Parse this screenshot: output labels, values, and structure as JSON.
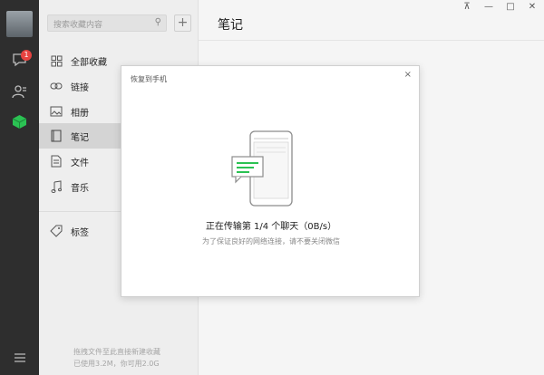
{
  "window": {
    "controls": [
      "⊼",
      "—",
      "□",
      "✕"
    ]
  },
  "rail": {
    "badge": "1"
  },
  "search": {
    "placeholder": "搜索收藏内容"
  },
  "nav": {
    "items": [
      {
        "label": "全部收藏",
        "icon": "grid-icon"
      },
      {
        "label": "链接",
        "icon": "link-icon"
      },
      {
        "label": "相册",
        "icon": "image-icon"
      },
      {
        "label": "笔记",
        "icon": "note-icon"
      },
      {
        "label": "文件",
        "icon": "file-icon"
      },
      {
        "label": "音乐",
        "icon": "music-icon"
      }
    ],
    "tag": {
      "label": "标签",
      "icon": "tag-icon"
    },
    "active": "笔记"
  },
  "footer": {
    "line1": "拖拽文件至此直接新建收藏",
    "line2": "已使用3.2M，你可用2.0G"
  },
  "main": {
    "title": "笔记"
  },
  "dialog": {
    "title": "恢复到手机",
    "close": "×",
    "status": "正在传输第 1/4 个聊天（0B/s）",
    "hint": "为了保证良好的网络连接，请不要关闭微信"
  },
  "colors": {
    "rail": "#2e2e2e",
    "accent_green": "#2bc253",
    "badge_red": "#e64340"
  }
}
